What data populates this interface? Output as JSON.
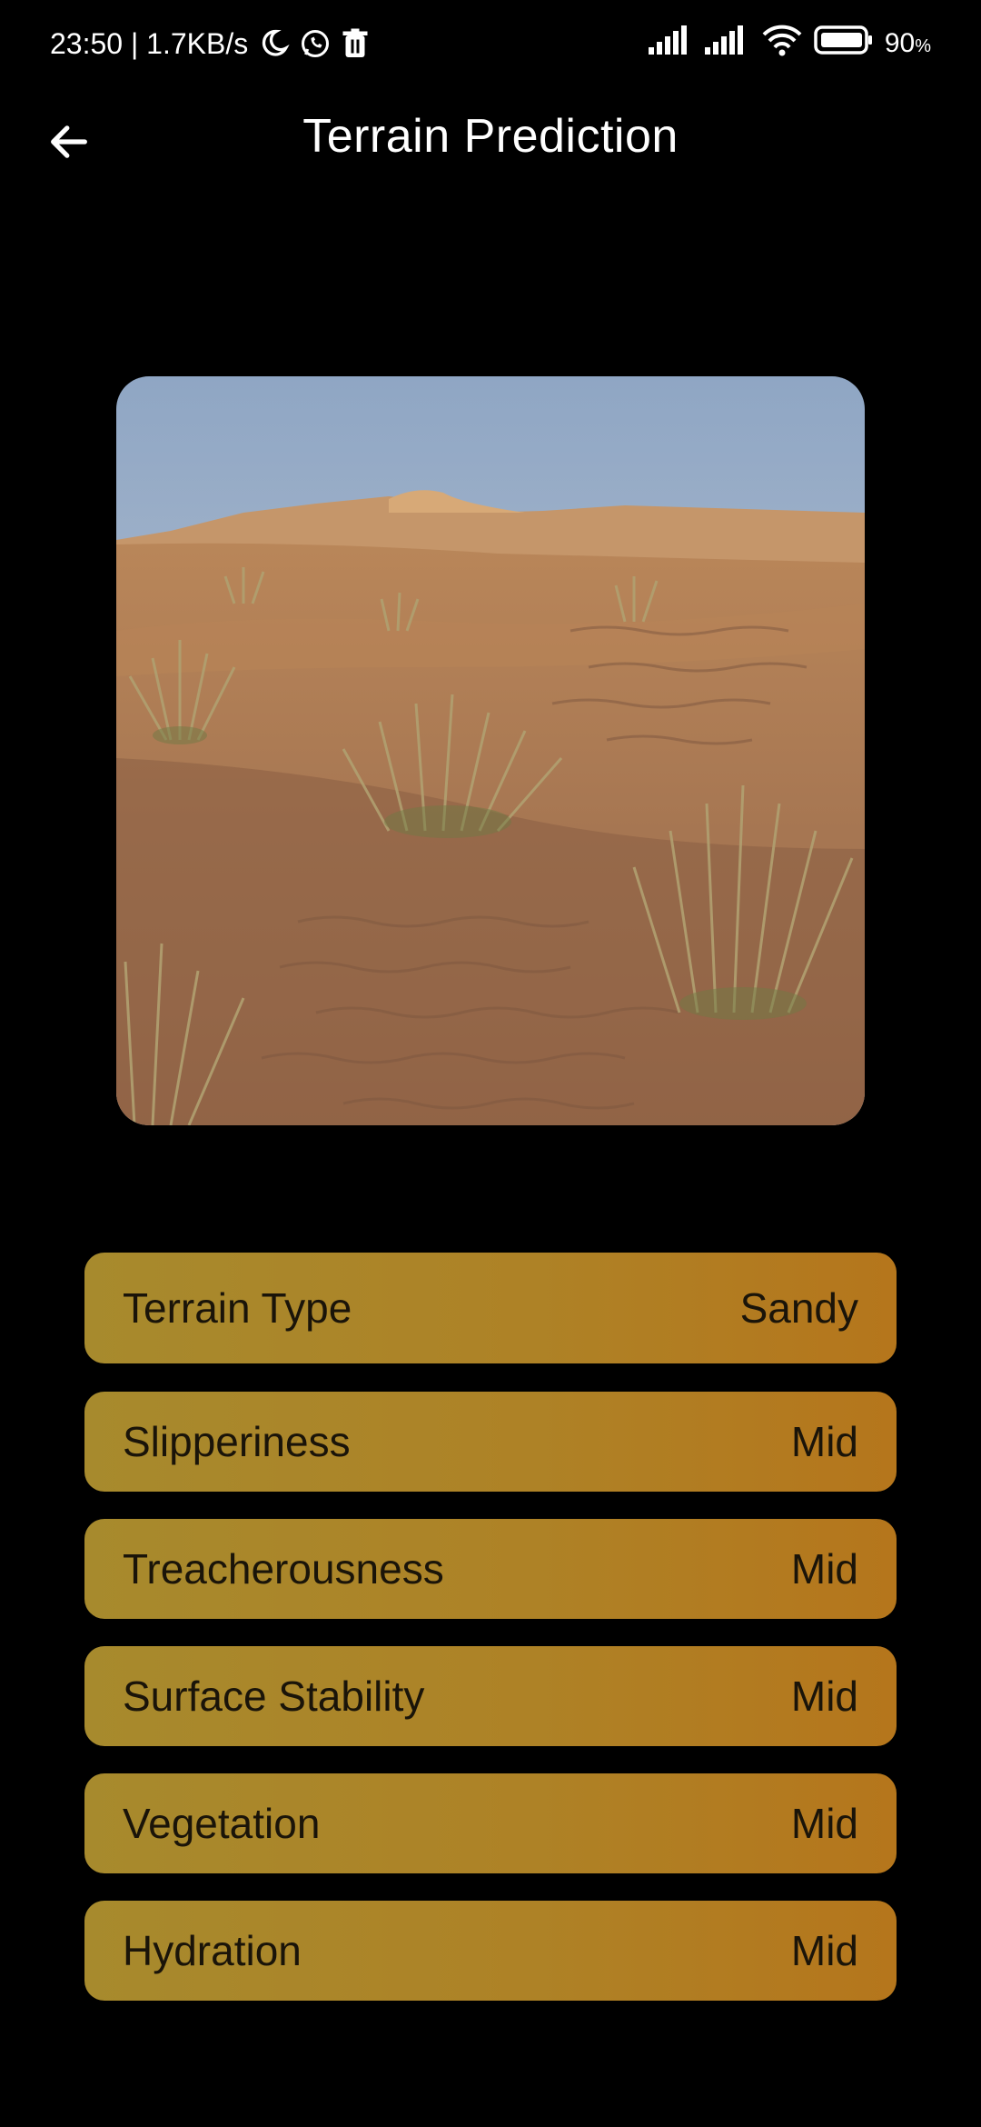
{
  "status_bar": {
    "time_speed": "23:50 | 1.7KB/s",
    "battery_percent": "90",
    "battery_unit": "%",
    "icons": [
      "moon-icon",
      "whatsapp-icon",
      "trash-icon",
      "signal-icon",
      "signal-icon",
      "wifi-icon",
      "battery-icon"
    ]
  },
  "app_bar": {
    "title": "Terrain Prediction",
    "back_icon": "back-arrow-icon"
  },
  "photo": {
    "subject": "desert-sand-dunes-with-grass"
  },
  "results": [
    {
      "label": "Terrain Type",
      "value": "Sandy"
    },
    {
      "label": "Slipperiness",
      "value": "Mid"
    },
    {
      "label": "Treacherousness",
      "value": "Mid"
    },
    {
      "label": "Surface Stability",
      "value": "Mid"
    },
    {
      "label": "Vegetation",
      "value": "Mid"
    },
    {
      "label": "Hydration",
      "value": "Mid"
    }
  ],
  "colors": {
    "background": "#000000",
    "card_start": "#a78a2d",
    "card_end": "#b5761c",
    "card_text": "#1a1409"
  }
}
